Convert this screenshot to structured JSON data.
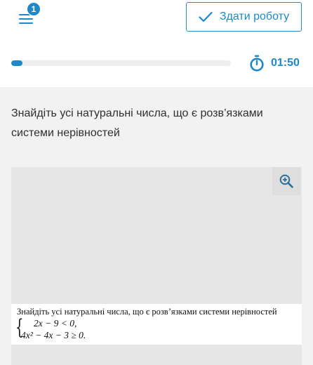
{
  "header": {
    "menu_badge": "1",
    "submit_label": "Здати роботу",
    "timer": "01:50",
    "progress": 0.05
  },
  "question": {
    "text": "Знайдіть усі натуральні числа, що є розв’язками системи нерівностей"
  },
  "task_image": {
    "title": "Знайдіть усі натуральні числа, що є розв’язками системи нерівностей",
    "brace": "{",
    "line1": "2x − 9 < 0,",
    "line2": "4x² − 4x − 3 ≥ 0."
  },
  "colors": {
    "accent": "#1e88c8",
    "content_bg": "#f2f2f2",
    "image_bg": "#e6e6e6"
  },
  "icons": {
    "menu": "menu-icon",
    "submit": "check-icon",
    "timer": "stopwatch-icon",
    "zoom": "zoom-in-icon"
  }
}
